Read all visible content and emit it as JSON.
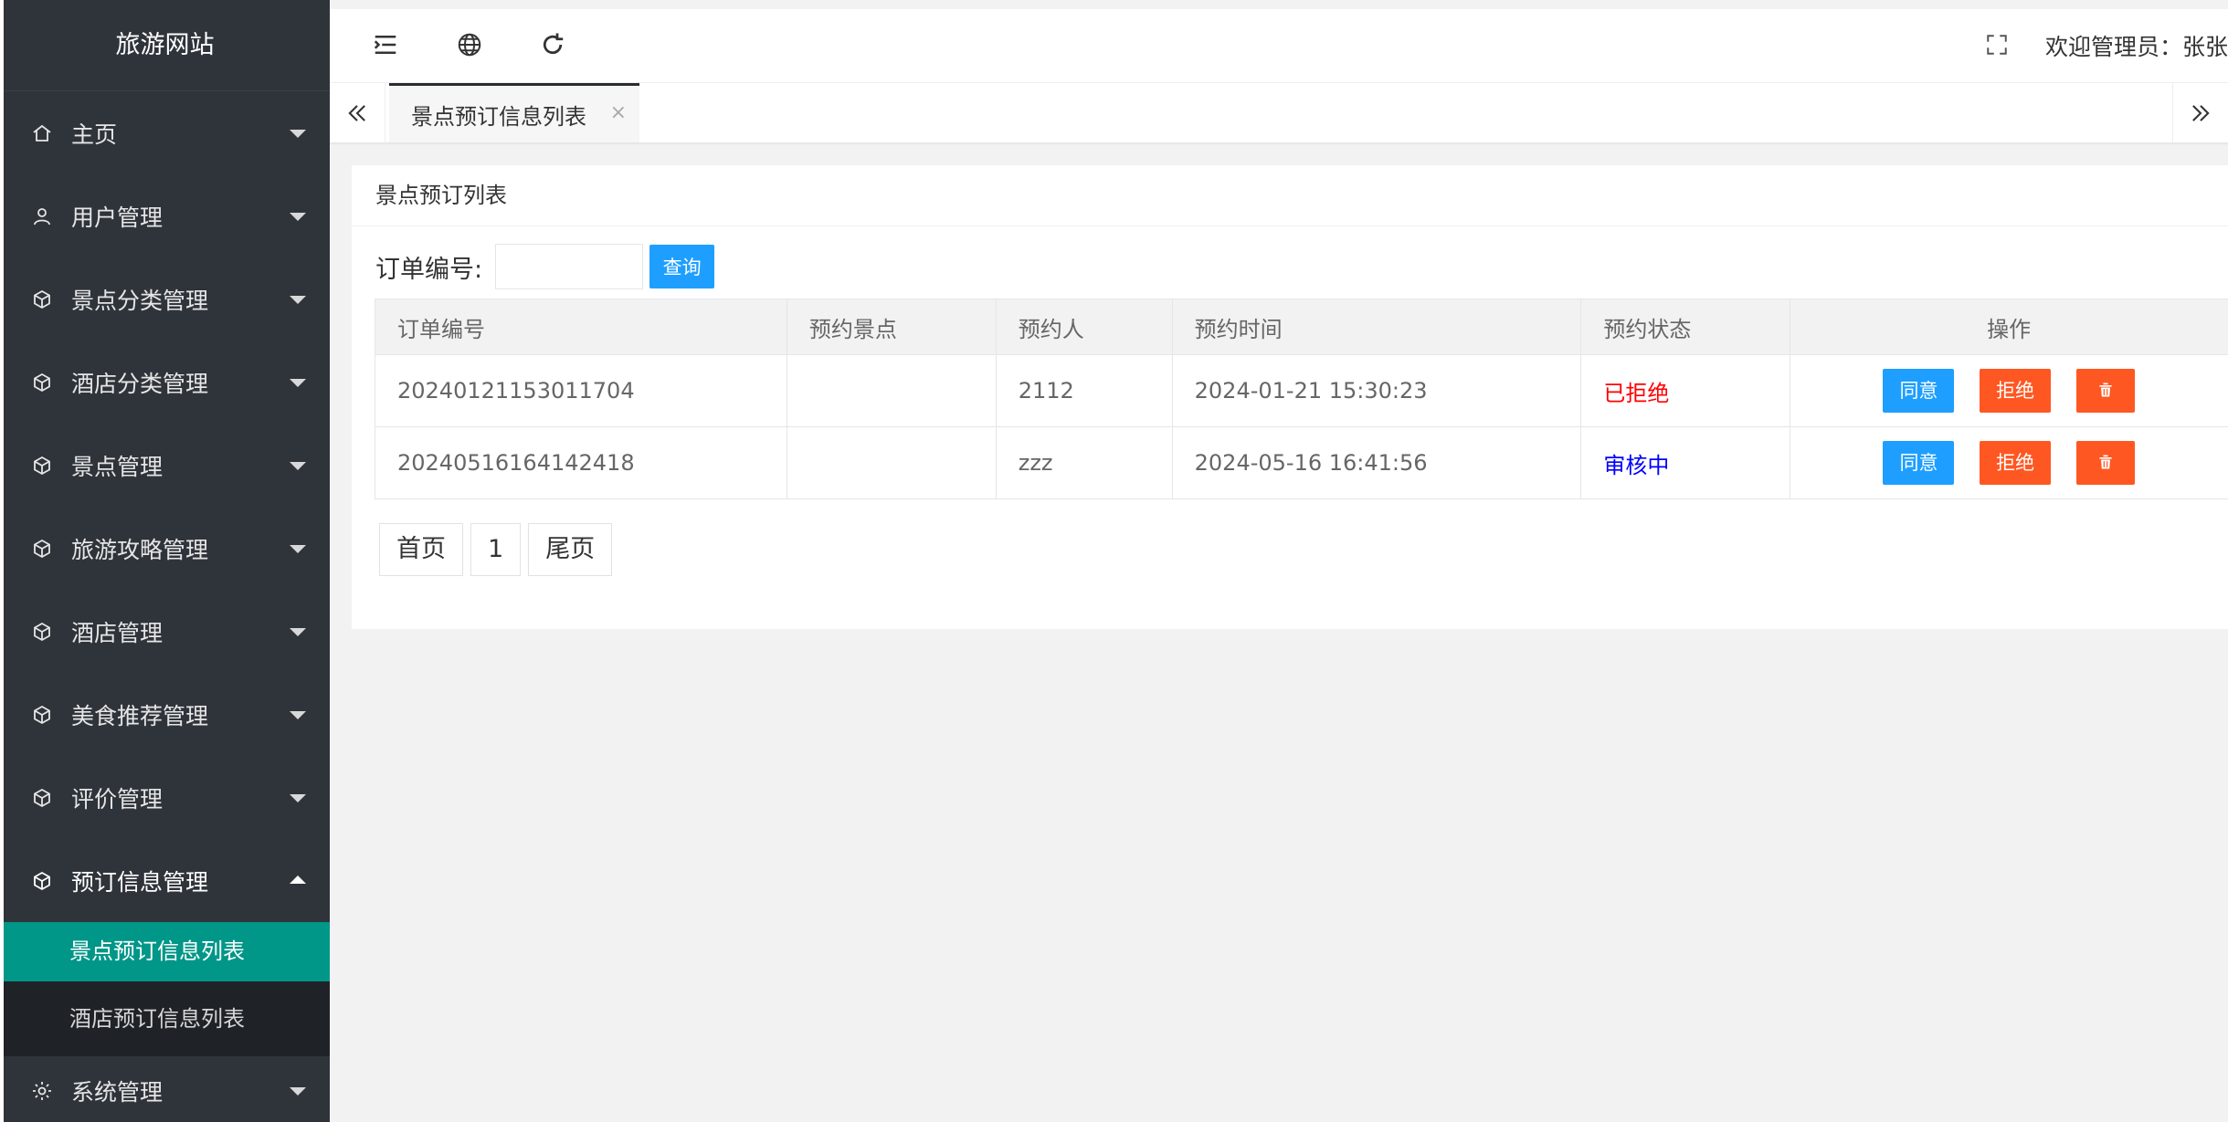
{
  "app": {
    "title": "旅游网站"
  },
  "sidebar": {
    "items": [
      {
        "label": "主页",
        "icon": "home-icon"
      },
      {
        "label": "用户管理",
        "icon": "user-icon"
      },
      {
        "label": "景点分类管理",
        "icon": "cube-icon"
      },
      {
        "label": "酒店分类管理",
        "icon": "cube-icon"
      },
      {
        "label": "景点管理",
        "icon": "cube-icon"
      },
      {
        "label": "旅游攻略管理",
        "icon": "cube-icon"
      },
      {
        "label": "酒店管理",
        "icon": "cube-icon"
      },
      {
        "label": "美食推荐管理",
        "icon": "cube-icon"
      },
      {
        "label": "评价管理",
        "icon": "cube-icon"
      },
      {
        "label": "预订信息管理",
        "icon": "cube-icon"
      },
      {
        "label": "系统管理",
        "icon": "gear-icon"
      }
    ],
    "submenu": [
      {
        "label": "景点预订信息列表"
      },
      {
        "label": "酒店预订信息列表"
      }
    ],
    "active_color": "#009688"
  },
  "header": {
    "welcome": "欢迎管理员：张张"
  },
  "tabs": [
    {
      "label": "景点预订信息列表",
      "close": "×"
    }
  ],
  "card": {
    "title": "景点预订列表",
    "search": {
      "label": "订单编号:",
      "value": "",
      "button": "查询"
    },
    "table": {
      "headers": [
        "订单编号",
        "预约景点",
        "预约人",
        "预约时间",
        "预约状态",
        "操作"
      ],
      "rows": [
        {
          "order_no": "20240121153011704",
          "spot": "",
          "person": "2112",
          "time": "2024-01-21 15:30:23",
          "status": "已拒绝"
        },
        {
          "order_no": "20240516164142418",
          "spot": "",
          "person": "zzz",
          "time": "2024-05-16 16:41:56",
          "status": "审核中"
        }
      ],
      "actions": {
        "agree": "同意",
        "reject": "拒绝"
      }
    },
    "pager": {
      "first": "首页",
      "current": "1",
      "last": "尾页"
    }
  },
  "colors": {
    "primary_button": "#1e9fff",
    "danger_button": "#ff5722",
    "rejected_text": "#ff0000",
    "pending_text": "#0000ff"
  }
}
